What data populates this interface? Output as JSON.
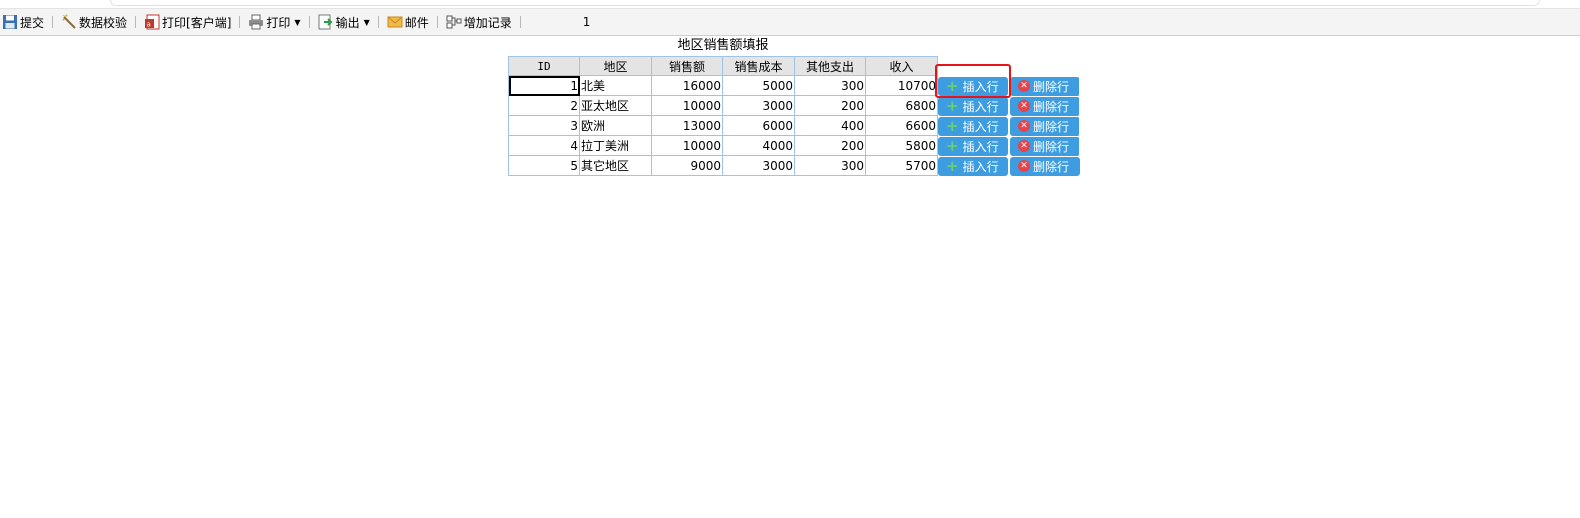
{
  "toolbar": {
    "submit": "提交",
    "validate": "数据校验",
    "print_client": "打印[客户端]",
    "print": "打印",
    "export": "输出",
    "mail": "邮件",
    "add_record": "增加记录",
    "page_number": "1"
  },
  "report": {
    "title": "地区销售额填报",
    "headers": [
      "ID",
      "地区",
      "销售额",
      "销售成本",
      "其他支出",
      "收入"
    ],
    "rows": [
      {
        "id": "1",
        "region": "北美",
        "sales": "16000",
        "cost": "5000",
        "other": "300",
        "income": "10700"
      },
      {
        "id": "2",
        "region": "亚太地区",
        "sales": "10000",
        "cost": "3000",
        "other": "200",
        "income": "6800"
      },
      {
        "id": "3",
        "region": "欧洲",
        "sales": "13000",
        "cost": "6000",
        "other": "400",
        "income": "6600"
      },
      {
        "id": "4",
        "region": "拉丁美洲",
        "sales": "10000",
        "cost": "4000",
        "other": "200",
        "income": "5800"
      },
      {
        "id": "5",
        "region": "其它地区",
        "sales": "9000",
        "cost": "3000",
        "other": "300",
        "income": "5700"
      }
    ],
    "insert_label": "插入行",
    "delete_label": "删除行"
  },
  "colors": {
    "button_blue": "#3d9de0",
    "highlight_red": "#e6131a",
    "grid_border": "#9fc4e6"
  }
}
